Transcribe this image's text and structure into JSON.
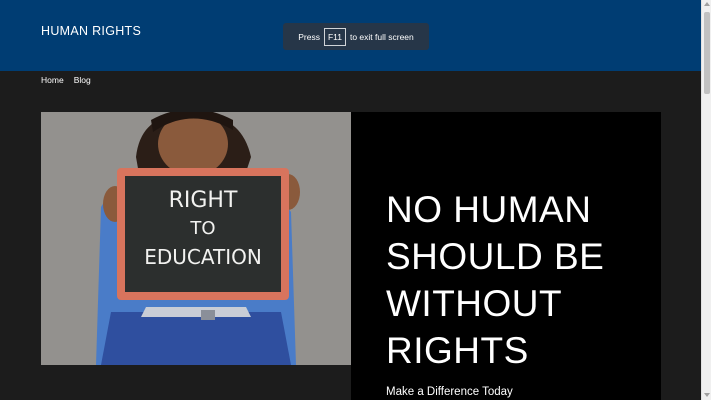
{
  "header": {
    "site_title": "HUMAN RIGHTS",
    "background_color": "#003d73"
  },
  "fullscreen_toast": {
    "prefix": "Press",
    "key": "F11",
    "suffix": "to exit full screen"
  },
  "nav": {
    "items": [
      {
        "label": "Home"
      },
      {
        "label": "Blog"
      }
    ]
  },
  "hero": {
    "image": {
      "sign_line1": "RIGHT",
      "sign_line2": "TO",
      "sign_line3": "EDUCATION"
    },
    "heading": "NO HUMAN SHOULD BE WITHOUT RIGHTS",
    "subheading": "Make a Difference Today"
  }
}
